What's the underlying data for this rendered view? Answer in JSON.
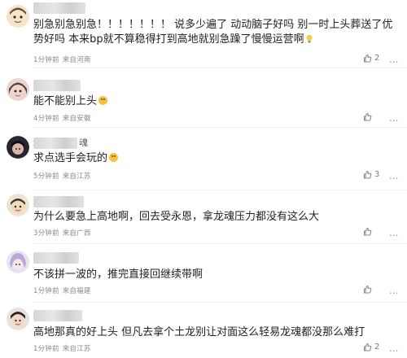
{
  "comments": [
    {
      "username_tail": "",
      "text": "别急别急别急！！！！！！！ 说多少遍了 动动脑子好吗 别一时上头葬送了优势好吗 本来bp就不算稳得打到高地就别急躁了慢慢运营啊",
      "emoji": "lightbulb",
      "time": "1分钟前",
      "location": "来自河南",
      "likes": "2"
    },
    {
      "username_tail": "",
      "text": "能不能别上头",
      "emoji": "slightly-smiling",
      "time": "4分钟前",
      "location": "来自安徽",
      "likes": ""
    },
    {
      "username_tail": "魂",
      "text": "求点选手会玩的",
      "emoji": "pensive",
      "time": "5分钟前",
      "location": "来自江苏",
      "likes": "3"
    },
    {
      "username_tail": "",
      "text": "为什么要急上高地啊，回去受永恩，拿龙魂压力都没有这么大",
      "emoji": "",
      "time": "3分钟前",
      "location": "来自广西",
      "likes": ""
    },
    {
      "username_tail": "",
      "text": "不该拼一波的，推完直接回继续带啊",
      "emoji": "",
      "time": "1分钟前",
      "location": "来自福建",
      "likes": ""
    },
    {
      "username_tail": "",
      "text": "高地那真的好上头 但凡去拿个土龙别让对面这么轻易龙魂都没那么难打",
      "emoji": "",
      "time": "1分钟前",
      "location": "来自江苏",
      "likes": "2"
    }
  ],
  "more_label": "...",
  "colors": {
    "text": "#222222",
    "meta": "#8a8a8a",
    "divider": "#efefef",
    "emoji": "#f6c23e"
  },
  "icons": {
    "like": "thumbs-up-icon",
    "comment": "comment-bubble-icon",
    "more": "more-dots-icon"
  }
}
